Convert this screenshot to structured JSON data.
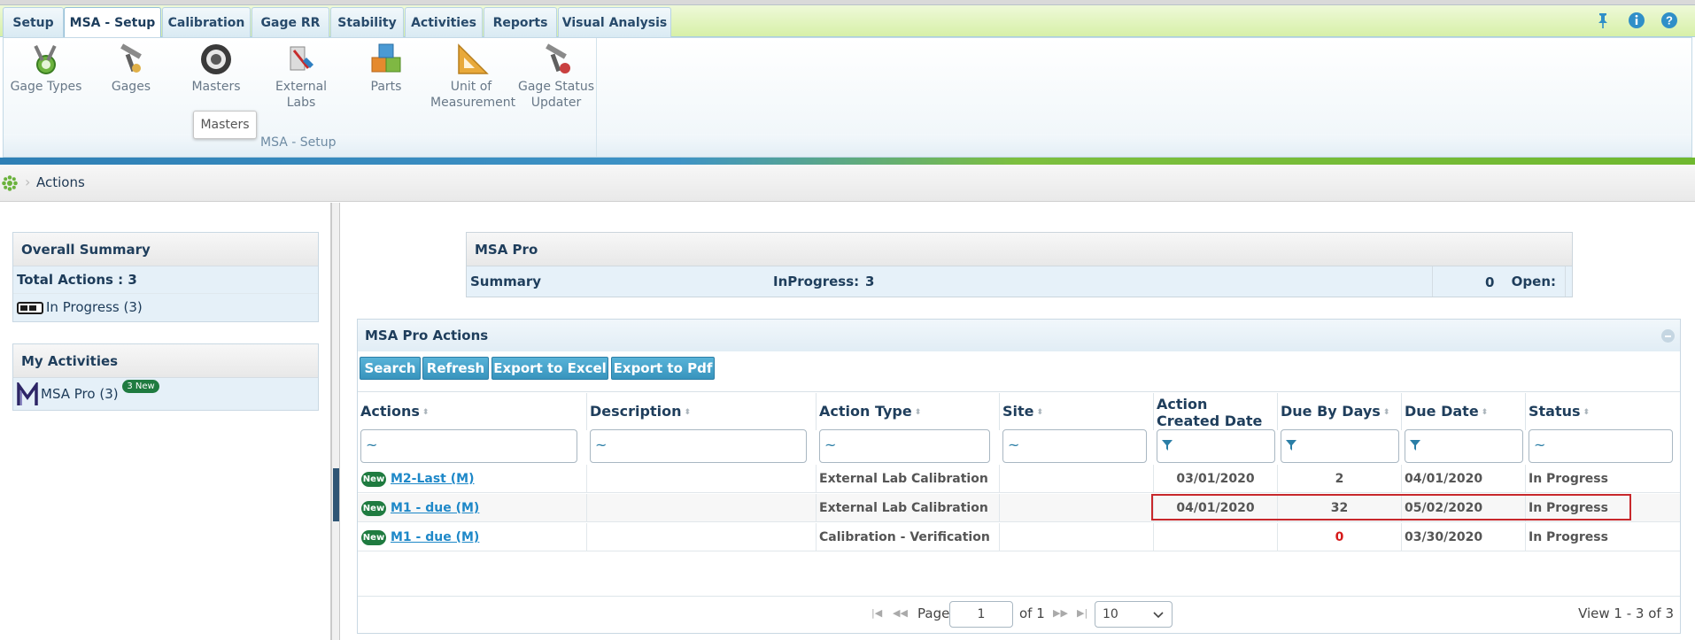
{
  "tabs": [
    {
      "label": "Setup",
      "active": false
    },
    {
      "label": "MSA - Setup",
      "active": true
    },
    {
      "label": "Calibration",
      "active": false
    },
    {
      "label": "Gage RR",
      "active": false
    },
    {
      "label": "Stability",
      "active": false
    },
    {
      "label": "Activities",
      "active": false
    },
    {
      "label": "Reports",
      "active": false
    },
    {
      "label": "Visual Analysis",
      "active": false
    }
  ],
  "ribbon": {
    "items": [
      {
        "label": "Gage Types",
        "icon": "gage-types-icon"
      },
      {
        "label": "Gages",
        "icon": "gages-icon"
      },
      {
        "label": "Masters",
        "icon": "masters-icon"
      },
      {
        "label": "External Labs",
        "icon": "external-labs-icon"
      },
      {
        "label": "Parts",
        "icon": "parts-icon"
      },
      {
        "label": "Unit of Measurement",
        "icon": "unit-of-measurement-icon"
      },
      {
        "label": "Gage Status Updater",
        "icon": "gage-status-updater-icon"
      }
    ],
    "tooltip": "Masters",
    "group_label": "MSA - Setup"
  },
  "breadcrumb": {
    "current": "Actions"
  },
  "left": {
    "overall_title": "Overall Summary",
    "total_actions": "Total Actions : 3",
    "in_progress": "In Progress (3)",
    "my_activities_title": "My Activities",
    "msa_pro": "MSA Pro (3)",
    "new_badge": "3 New"
  },
  "summary": {
    "title": "MSA Pro",
    "label": "Summary",
    "inprogress_label": "InProgress:",
    "inprogress_value": "3",
    "open_label": "Open:",
    "open_value": "0"
  },
  "grid": {
    "title": "MSA Pro Actions",
    "buttons": [
      "Search",
      "Refresh",
      "Export to Excel",
      "Export to Pdf"
    ],
    "columns": [
      "Actions",
      "Description",
      "Action Type",
      "Site",
      "Action Created Date",
      "Due By Days",
      "Due Date",
      "Status"
    ],
    "filter_symbols": [
      "~",
      "~",
      "~",
      "~",
      "filter-icon",
      "filter-icon",
      "filter-icon",
      "~"
    ],
    "rows": [
      {
        "badge": "New",
        "action": "M2-Last (M)",
        "description": "",
        "type": "External Lab Calibration",
        "site": "",
        "created": "03/01/2020",
        "due_days": "2",
        "due_date": "04/01/2020",
        "status": "In Progress"
      },
      {
        "badge": "New",
        "action": "M1 - due (M)",
        "description": "",
        "type": "External Lab Calibration",
        "site": "",
        "created": "04/01/2020",
        "due_days": "32",
        "due_date": "05/02/2020",
        "status": "In Progress"
      },
      {
        "badge": "New",
        "action": "M1 - due (M)",
        "description": "",
        "type": "Calibration - Verification",
        "site": "",
        "created": "",
        "due_days": "0",
        "due_date": "03/30/2020",
        "status": "In Progress"
      }
    ],
    "pager": {
      "page_label": "Page",
      "page_value": "1",
      "of_label": "of 1",
      "page_size": "10",
      "view_text": "View 1 - 3 of 3"
    }
  },
  "colors": {
    "accent": "#3894bd",
    "new_badge": "#1f7b40",
    "overdue": "#d51a1a",
    "highlight": "#c8282c"
  }
}
